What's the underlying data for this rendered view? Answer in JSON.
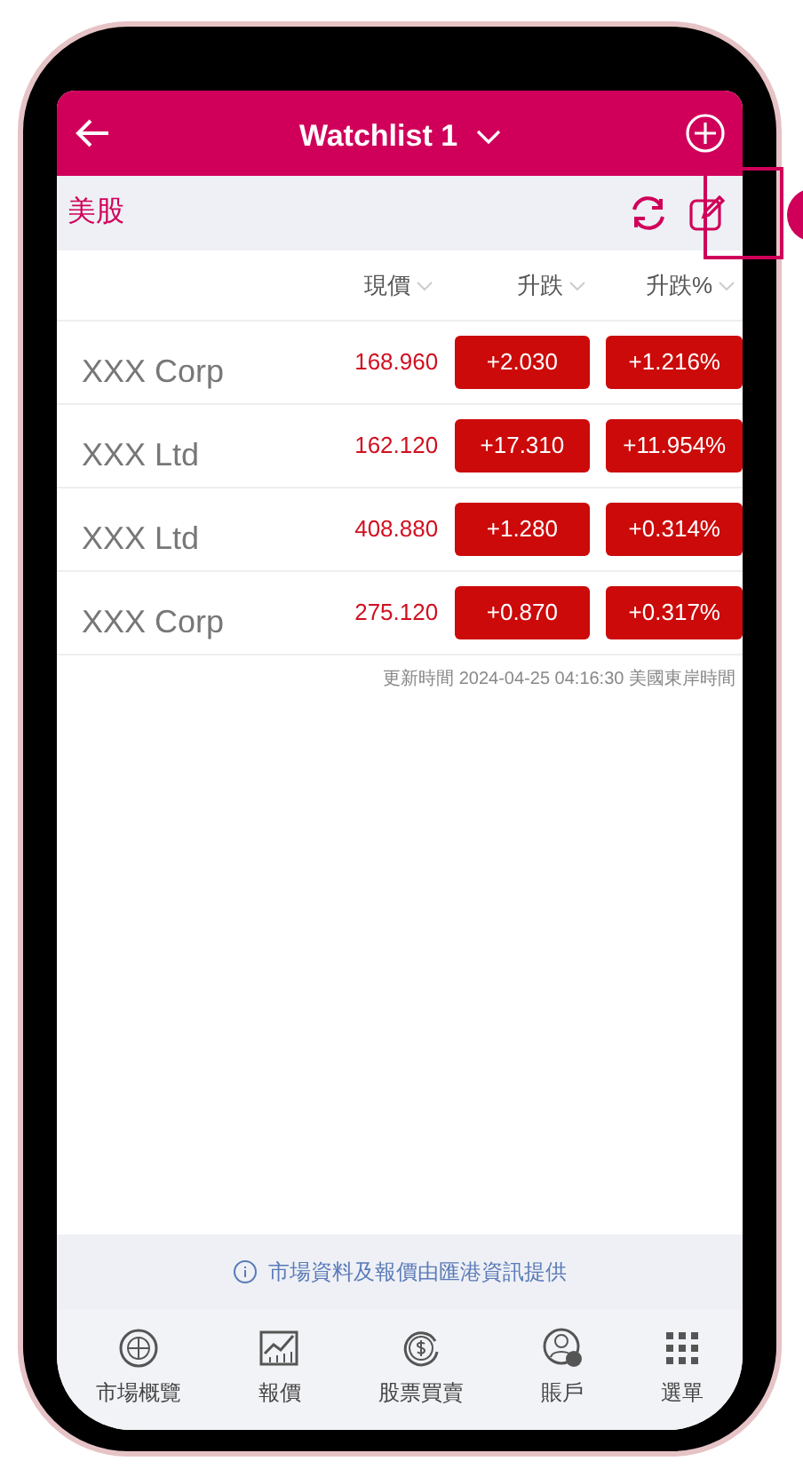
{
  "header": {
    "title": "Watchlist 1"
  },
  "market": {
    "label": "美股"
  },
  "columns": [
    {
      "label": "現價"
    },
    {
      "label": "升跌"
    },
    {
      "label": "升跌%"
    }
  ],
  "rows": [
    {
      "name": "XXX Corp",
      "price": "168.960",
      "change": "+2.030",
      "change_pct": "+1.216%"
    },
    {
      "name": "XXX Ltd",
      "price": "162.120",
      "change": "+17.310",
      "change_pct": "+11.954%"
    },
    {
      "name": "XXX Ltd",
      "price": "408.880",
      "change": "+1.280",
      "change_pct": "+0.314%"
    },
    {
      "name": "XXX Corp",
      "price": "275.120",
      "change": "+0.870",
      "change_pct": "+0.317%"
    }
  ],
  "update_time": "更新時間 2024-04-25 04:16:30 美國東岸時間",
  "info": "市場資料及報價由匯港資訊提供",
  "nav": [
    {
      "kind": "globe",
      "label": "市場概覽"
    },
    {
      "kind": "chart",
      "label": "報價"
    },
    {
      "kind": "dollar",
      "label": "股票買賣"
    },
    {
      "kind": "account",
      "label": "賬戶"
    },
    {
      "kind": "grid",
      "label": "選單"
    }
  ]
}
